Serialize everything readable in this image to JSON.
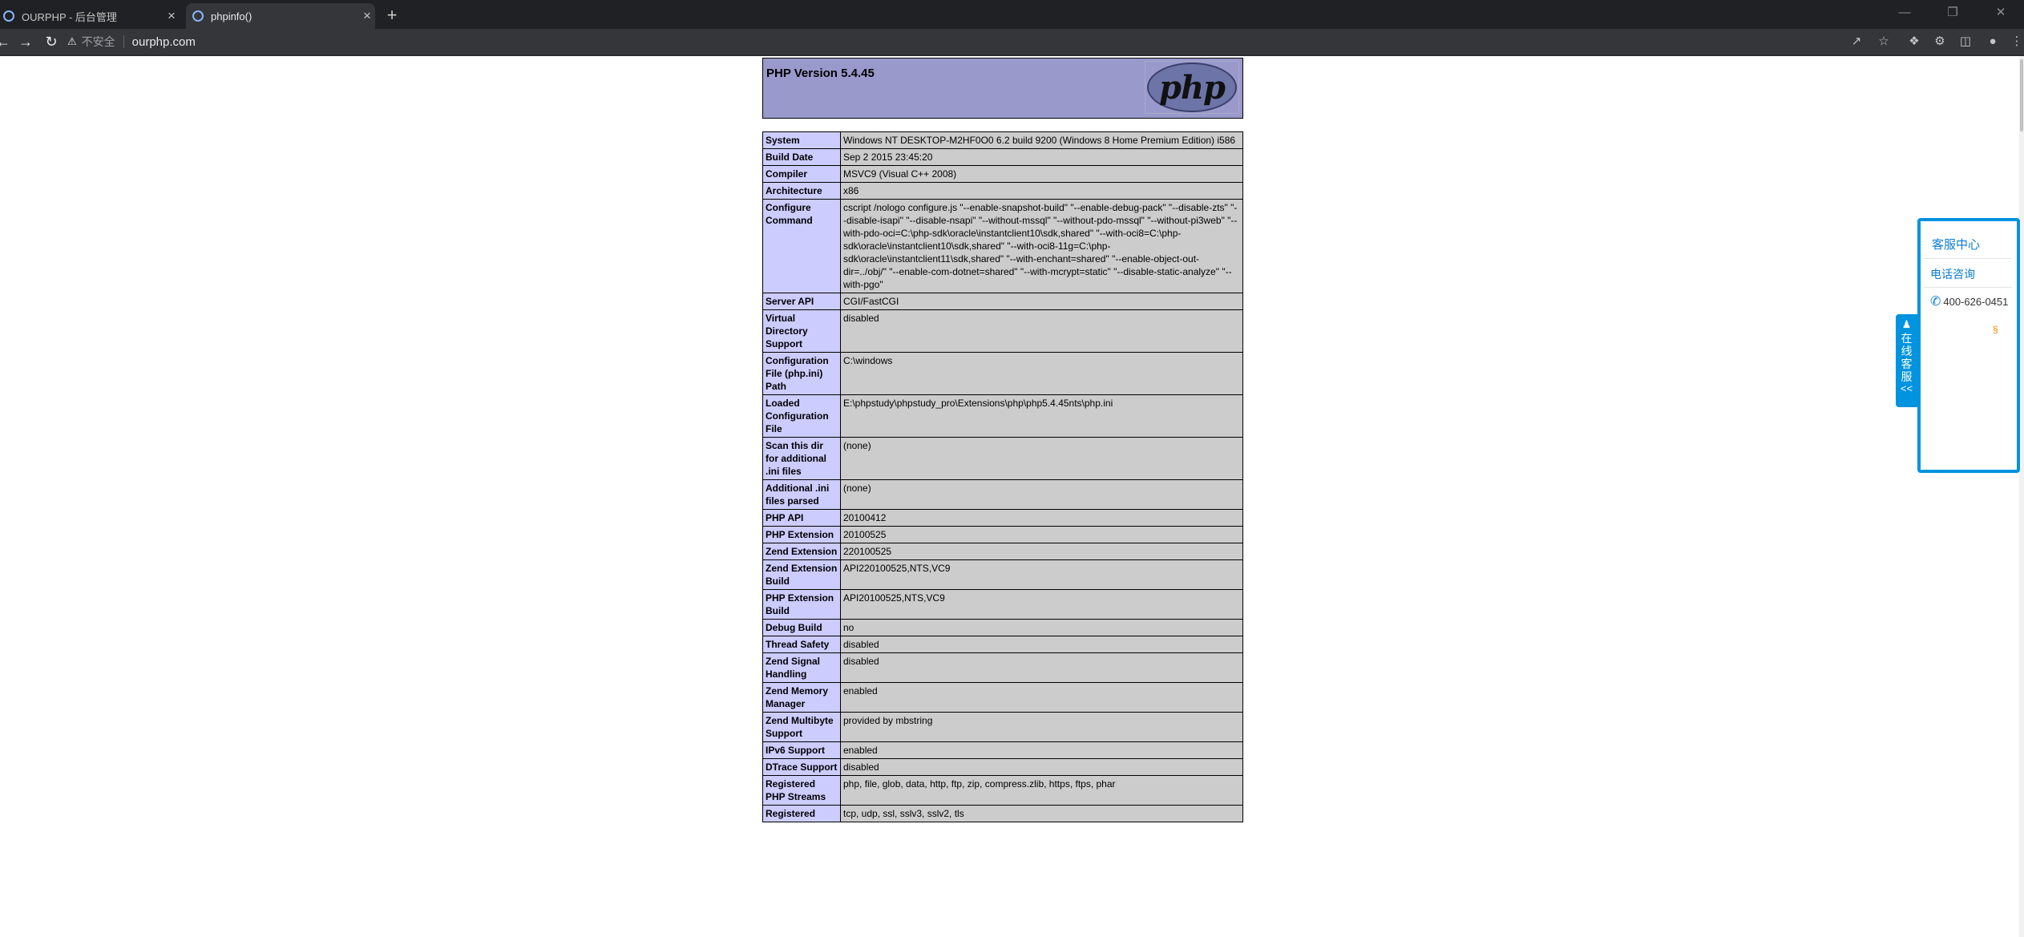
{
  "browser": {
    "tabs": [
      {
        "title": "OURPHP - 后台管理",
        "active": false
      },
      {
        "title": "phpinfo()",
        "active": true
      }
    ],
    "new_tab_symbol": "+",
    "close_symbol": "×",
    "security_label": "不安全",
    "url": "ourphp.com",
    "icons": {
      "back": "back-arrow-icon",
      "forward": "forward-arrow-icon",
      "reload": "reload-icon",
      "warning": "warning-triangle-icon",
      "share": "share-icon",
      "star": "star-icon",
      "extensions": "puzzle-icon",
      "profile": "person-icon",
      "menu": "kebab-menu-icon"
    }
  },
  "phpinfo": {
    "version_heading": "PHP Version 5.4.45",
    "logo_text": "php",
    "rows": [
      {
        "key": "System",
        "value": "Windows NT DESKTOP-M2HF0O0 6.2 build 9200 (Windows 8 Home Premium Edition) i586"
      },
      {
        "key": "Build Date",
        "value": "Sep 2 2015 23:45:20"
      },
      {
        "key": "Compiler",
        "value": "MSVC9 (Visual C++ 2008)"
      },
      {
        "key": "Architecture",
        "value": "x86"
      },
      {
        "key": "Configure Command",
        "value": "cscript /nologo configure.js \"--enable-snapshot-build\" \"--enable-debug-pack\" \"--disable-zts\" \"--disable-isapi\" \"--disable-nsapi\" \"--without-mssql\" \"--without-pdo-mssql\" \"--without-pi3web\" \"--with-pdo-oci=C:\\php-sdk\\oracle\\instantclient10\\sdk,shared\" \"--with-oci8=C:\\php-sdk\\oracle\\instantclient10\\sdk,shared\" \"--with-oci8-11g=C:\\php-sdk\\oracle\\instantclient11\\sdk,shared\" \"--with-enchant=shared\" \"--enable-object-out-dir=../obj/\" \"--enable-com-dotnet=shared\" \"--with-mcrypt=static\" \"--disable-static-analyze\" \"--with-pgo\""
      },
      {
        "key": "Server API",
        "value": "CGI/FastCGI"
      },
      {
        "key": "Virtual Directory Support",
        "value": "disabled"
      },
      {
        "key": "Configuration File (php.ini) Path",
        "value": "C:\\windows"
      },
      {
        "key": "Loaded Configuration File",
        "value": "E:\\phpstudy\\phpstudy_pro\\Extensions\\php\\php5.4.45nts\\php.ini"
      },
      {
        "key": "Scan this dir for additional .ini files",
        "value": "(none)"
      },
      {
        "key": "Additional .ini files parsed",
        "value": "(none)"
      },
      {
        "key": "PHP API",
        "value": "20100412"
      },
      {
        "key": "PHP Extension",
        "value": "20100525"
      },
      {
        "key": "Zend Extension",
        "value": "220100525"
      },
      {
        "key": "Zend Extension Build",
        "value": "API220100525,NTS,VC9"
      },
      {
        "key": "PHP Extension Build",
        "value": "API20100525,NTS,VC9"
      },
      {
        "key": "Debug Build",
        "value": "no"
      },
      {
        "key": "Thread Safety",
        "value": "disabled"
      },
      {
        "key": "Zend Signal Handling",
        "value": "disabled"
      },
      {
        "key": "Zend Memory Manager",
        "value": "enabled"
      },
      {
        "key": "Zend Multibyte Support",
        "value": "provided by mbstring"
      },
      {
        "key": "IPv6 Support",
        "value": "enabled"
      },
      {
        "key": "DTrace Support",
        "value": "disabled"
      },
      {
        "key": "Registered PHP Streams",
        "value": "php, file, glob, data, http, ftp, zip, compress.zlib, https, ftps, phar"
      },
      {
        "key": "Registered",
        "value": "tcp, udp, ssl, sslv3, sslv2, tls"
      }
    ]
  },
  "cs_widget": {
    "title": "客服中心",
    "phone_consult": "电话咨询",
    "phone_number": "400-626-0451",
    "link_symbol": "§",
    "tab_chars": [
      "在",
      "线",
      "客",
      "服"
    ],
    "tab_arrow": "<<",
    "accent_color": "#0093e0"
  }
}
